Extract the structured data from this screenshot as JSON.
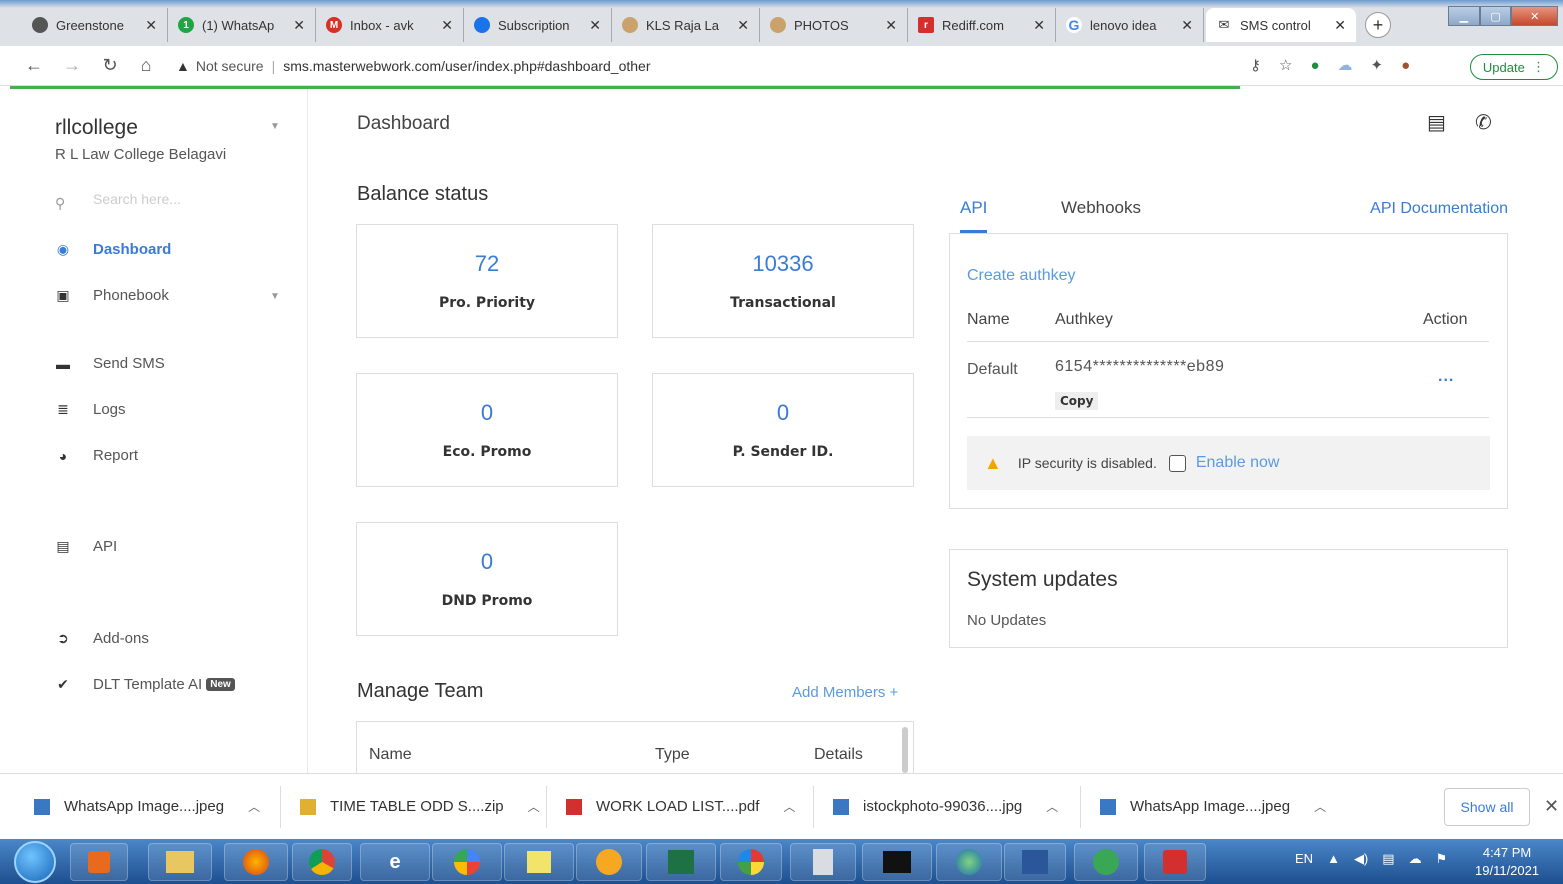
{
  "browser": {
    "tabs": [
      {
        "title": "Greenstone",
        "color": "#555555",
        "glyph": ""
      },
      {
        "title": "(1) WhatsAp",
        "color": "#25a244",
        "glyph": "1"
      },
      {
        "title": "Inbox - avk",
        "color": "#d93025",
        "glyph": "M"
      },
      {
        "title": "Subscription",
        "color": "#1a73e8",
        "glyph": ""
      },
      {
        "title": "KLS Raja La",
        "color": "#c9a36b",
        "glyph": ""
      },
      {
        "title": "PHOTOS",
        "color": "#c9a36b",
        "glyph": ""
      },
      {
        "title": "Rediff.com",
        "color": "#d32f2f",
        "glyph": "r"
      },
      {
        "title": "lenovo idea",
        "color": "#4285f4",
        "glyph": "G"
      },
      {
        "title": "SMS control",
        "color": "#333333",
        "glyph": "✉"
      }
    ],
    "address": {
      "security": "Not secure",
      "url": "sms.masterwebwork.com/user/index.php#dashboard_other"
    },
    "update_label": "Update"
  },
  "sidebar": {
    "account_name": "rllcollege",
    "account_sub": "R L Law College Belagavi",
    "search_placeholder": "Search here...",
    "items": [
      {
        "label": "Dashboard"
      },
      {
        "label": "Phonebook"
      },
      {
        "label": "Send SMS"
      },
      {
        "label": "Logs"
      },
      {
        "label": "Report"
      },
      {
        "label": "API"
      },
      {
        "label": "Add-ons"
      },
      {
        "label": "DLT Template AI",
        "badge": "New"
      }
    ]
  },
  "main": {
    "title": "Dashboard",
    "balance": {
      "title": "Balance status",
      "cards": [
        {
          "value": "72",
          "label": "Pro. Priority"
        },
        {
          "value": "10336",
          "label": "Transactional"
        },
        {
          "value": "0",
          "label": "Eco. Promo"
        },
        {
          "value": "0",
          "label": "P. Sender ID."
        },
        {
          "value": "0",
          "label": "DND Promo"
        }
      ]
    },
    "team": {
      "title": "Manage Team",
      "add_label": "Add Members +",
      "columns": [
        "Name",
        "Type",
        "Details"
      ]
    },
    "api": {
      "tabs": [
        "API",
        "Webhooks"
      ],
      "doc_link": "API Documentation",
      "create_label": "Create authkey",
      "columns": [
        "Name",
        "Authkey",
        "Action"
      ],
      "row": {
        "name": "Default",
        "key": "6154**************eb89",
        "copy": "Copy",
        "action": "..."
      },
      "ip_warning": "IP security is disabled.",
      "enable_label": "Enable now"
    },
    "system": {
      "title": "System updates",
      "text": "No Updates"
    }
  },
  "downloads": {
    "items": [
      {
        "name": "WhatsApp Image....jpeg",
        "color": "#3a78c3"
      },
      {
        "name": "TIME TABLE ODD S....zip",
        "color": "#e0b030"
      },
      {
        "name": "WORK LOAD LIST....pdf",
        "color": "#d32f2f"
      },
      {
        "name": "istockphoto-99036....jpg",
        "color": "#3a78c3"
      },
      {
        "name": "WhatsApp Image....jpeg",
        "color": "#3a78c3"
      }
    ],
    "show_all": "Show all"
  },
  "taskbar": {
    "lang": "EN",
    "time": "4:47 PM",
    "date": "19/11/2021"
  }
}
